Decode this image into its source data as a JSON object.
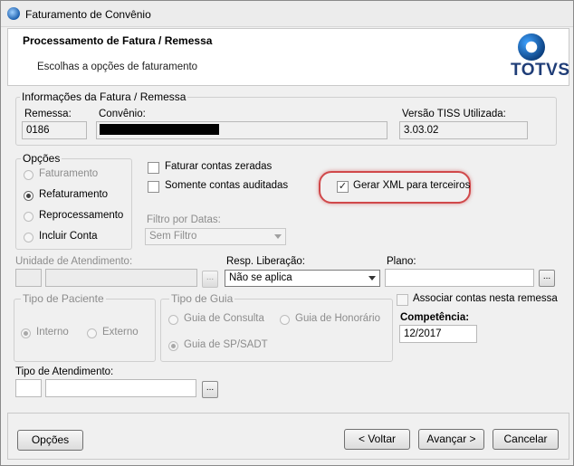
{
  "window": {
    "title": "Faturamento de Convênio"
  },
  "header": {
    "title": "Processamento de Fatura / Remessa",
    "subtitle": "Escolhas a opções de faturamento",
    "logo_text": "TOTVS"
  },
  "info_group": {
    "legend": "Informações da Fatura / Remessa",
    "remessa_label": "Remessa:",
    "remessa_value": "0186",
    "convenio_label": "Convênio:",
    "versao_label": "Versão TISS Utilizada:",
    "versao_value": "3.03.02"
  },
  "opcoes_group": {
    "legend": "Opções",
    "options": [
      {
        "label": "Faturamento",
        "selected": false
      },
      {
        "label": "Refaturamento",
        "selected": true
      },
      {
        "label": "Reprocessamento",
        "selected": false
      },
      {
        "label": "Incluir Conta",
        "selected": false
      }
    ]
  },
  "checks": {
    "faturar_zeradas": "Faturar contas zeradas",
    "somente_auditadas": "Somente contas auditadas",
    "gerar_xml": "Gerar XML para terceiros",
    "gerar_xml_checked": true
  },
  "filtro": {
    "label": "Filtro por Datas:",
    "value": "Sem Filtro"
  },
  "unidade": {
    "label": "Unidade de Atendimento:"
  },
  "resp": {
    "label": "Resp. Liberação:",
    "value": "Não se aplica"
  },
  "plano": {
    "label": "Plano:"
  },
  "tipo_paciente": {
    "legend": "Tipo de Paciente",
    "interno": "Interno",
    "externo": "Externo"
  },
  "tipo_guia": {
    "legend": "Tipo de Guia",
    "consulta": "Guia de Consulta",
    "honorario": "Guia de Honorário",
    "sp_sadt": "Guia de SP/SADT"
  },
  "associar": {
    "label": "Associar contas nesta remessa"
  },
  "competencia": {
    "label": "Competência:",
    "value": "12/2017"
  },
  "tipo_atendimento": {
    "label": "Tipo de Atendimento:"
  },
  "buttons": {
    "opcoes": "Opções",
    "voltar": "< Voltar",
    "avancar": "Avançar >",
    "cancelar": "Cancelar",
    "dots": "..."
  },
  "colors": {
    "highlight": "#d0484a",
    "logo": "#1f3d77"
  }
}
